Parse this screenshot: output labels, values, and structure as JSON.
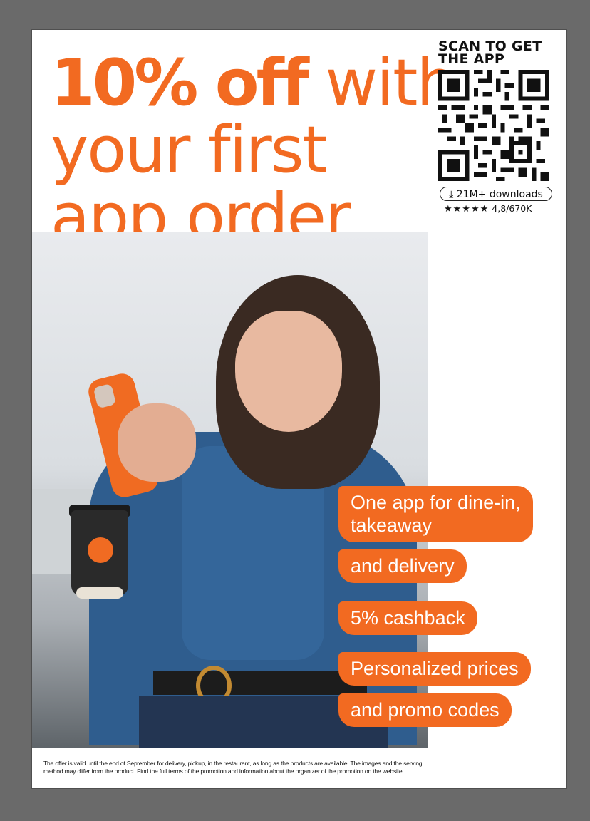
{
  "headline": {
    "bold": "10% off",
    "rest1": " with",
    "line2": "your first",
    "line3": "app order"
  },
  "qr": {
    "title_line1": "SCAN TO GET",
    "title_line2": "THE APP",
    "downloads": "21M+ downloads",
    "download_icon": "download-icon",
    "rating_stars": "★★★★★",
    "rating_text": "4,8/670K"
  },
  "features": {
    "b1_l1": "One app for dine-in,",
    "b1_l2": "takeaway",
    "b2": "and delivery",
    "b3": "5% cashback",
    "b4": "Personalized prices",
    "b5": "and promo codes"
  },
  "footnote": {
    "line1": "The offer is valid until the end of September for delivery, pickup, in the restaurant, as long as the products are available. The images and the serving",
    "line2": "method may differ from the product. Find the full terms of the promotion and information about the organizer of the promotion on the website"
  },
  "colors": {
    "brand_orange": "#f26a21",
    "background": "#6a6a6a",
    "poster": "#ffffff"
  }
}
